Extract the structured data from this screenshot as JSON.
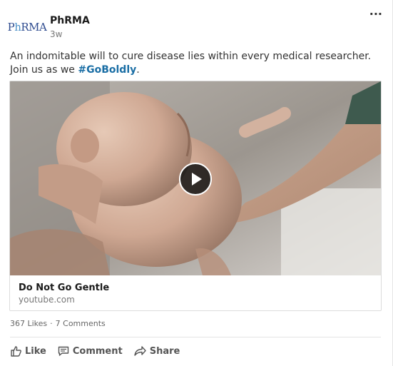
{
  "post": {
    "author": "PhRMA",
    "logo_text_a": "P",
    "logo_text_h": "h",
    "logo_text_b": "RMA",
    "time": "3w",
    "more_label": "...",
    "text": "An indomitable will to cure disease lies within every medical researcher. Join us as we ",
    "hashtag": "#GoBoldly",
    "text_end": "."
  },
  "media": {
    "title": "Do Not Go Gentle",
    "source": "youtube.com"
  },
  "stats": {
    "likes": "367 Likes",
    "separator": "·",
    "comments": "7 Comments"
  },
  "actions": {
    "like": "Like",
    "comment": "Comment",
    "share": "Share"
  },
  "colors": {
    "hashtag": "#1a6ea5",
    "logo": "#2e4b8f"
  },
  "icons": [
    "more-icon",
    "play-icon",
    "like-icon",
    "comment-icon",
    "share-icon"
  ]
}
